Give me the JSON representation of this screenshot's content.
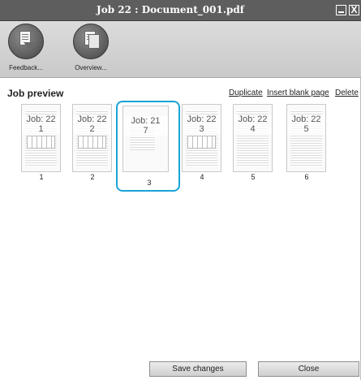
{
  "window": {
    "title": "Job 22 : Document_001.pdf",
    "close_symbol": "X"
  },
  "toolbar": {
    "items": [
      {
        "label": "Feedback...",
        "icon": "document-feedback-icon"
      },
      {
        "label": "Overview...",
        "icon": "document-overview-icon"
      }
    ]
  },
  "preview": {
    "title": "Job preview",
    "actions": {
      "duplicate": "Duplicate",
      "insert_blank": "Insert blank page",
      "delete": "Delete"
    },
    "selected_index": 3,
    "pages": [
      {
        "job_label": "Job: 22",
        "job_page": "1",
        "index": "1"
      },
      {
        "job_label": "Job: 22",
        "job_page": "2",
        "index": "2"
      },
      {
        "job_label": "Job: 21",
        "job_page": "7",
        "index": "3"
      },
      {
        "job_label": "Job: 22",
        "job_page": "3",
        "index": "4"
      },
      {
        "job_label": "Job: 22",
        "job_page": "4",
        "index": "5"
      },
      {
        "job_label": "Job: 22",
        "job_page": "5",
        "index": "6"
      }
    ]
  },
  "footer": {
    "save_label": "Save changes",
    "close_label": "Close"
  },
  "colors": {
    "selection": "#1aa3d8",
    "titlebar": "#5e5e5e"
  }
}
